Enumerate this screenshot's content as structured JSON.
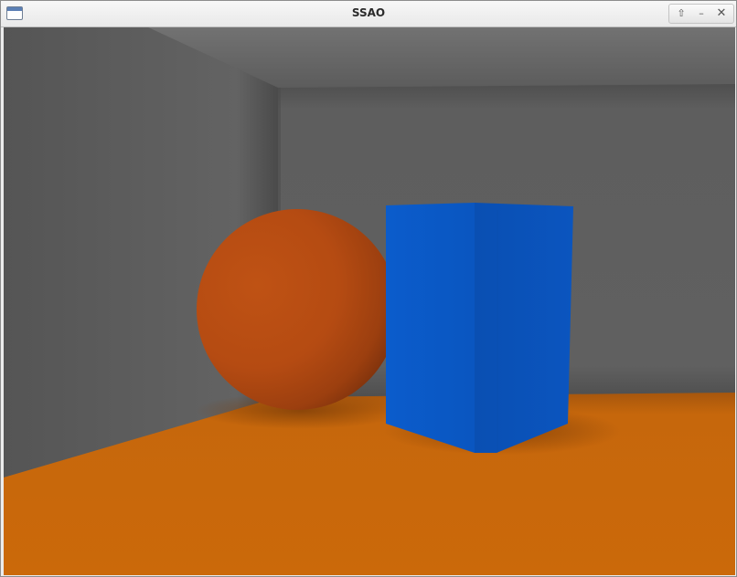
{
  "window": {
    "title": "SSAO",
    "icon": "window-icon",
    "controls": {
      "restore_icon": "restore-icon",
      "restore_glyph": "⇧",
      "minimize_icon": "minimize-icon",
      "minimize_glyph": "–",
      "close_icon": "close-icon",
      "close_glyph": "✕"
    }
  },
  "scene": {
    "description_hidden": "",
    "colors": {
      "wall": "#5f5f5f",
      "ceiling": "#6b6b6b",
      "floor": "#c8680c",
      "sphere": "#b84c12",
      "box_front": "#0b58c6",
      "box_side": "#0a4fb3"
    }
  }
}
